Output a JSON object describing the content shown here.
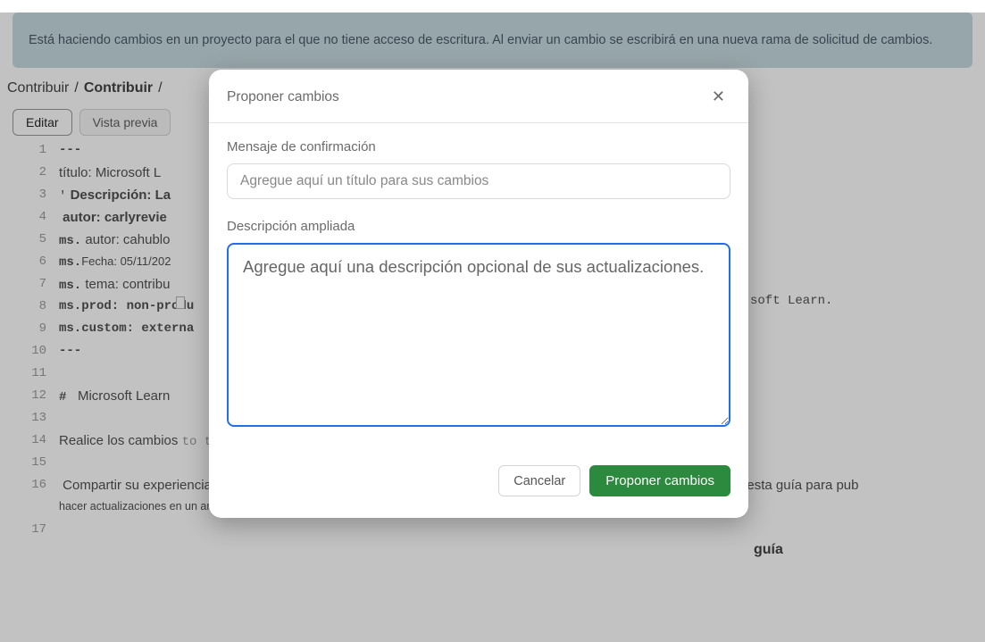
{
  "banner": {
    "text": "Está haciendo cambios en un proyecto para el que no tiene acceso de escritura. Al enviar un cambio se escribirá en una nueva rama de solicitud de cambios."
  },
  "breadcrumbs": {
    "items": [
      "Contribuir",
      "Contribuir"
    ],
    "sep": "/"
  },
  "tabs": {
    "edit": "Editar",
    "preview": "Vista previa"
  },
  "editor": {
    "line_numbers": [
      "1",
      "2",
      "3",
      "4",
      "5",
      "6",
      "7",
      "8",
      "9",
      "10",
      "11",
      "12",
      "13",
      "14",
      "15",
      "16",
      "",
      "17"
    ],
    "lines": [
      {
        "mono": "---"
      },
      {
        "sans": "título: Microsoft L"
      },
      {
        "sans": " Descripción: La ",
        "bold": true,
        "quote": true
      },
      {
        "sans": " autor: carlyrevie",
        "bold": true
      },
      {
        "mono": "ms.",
        "sans": " autor: cahublo"
      },
      {
        "mono": "ms.",
        "sans": "Fecha: 05/11/202",
        "small": true
      },
      {
        "mono": "ms.",
        "sans": " tema: contribu"
      },
      {
        "mono": "ms.prod: non-produ"
      },
      {
        "mono": "ms.custom: externa"
      },
      {
        "mono": "---"
      },
      {
        "mono": ""
      },
      {
        "mono": "# ",
        "sans": " Microsoft Learn"
      },
      {
        "mono": ""
      },
      {
        "sans": "Realice los cambios ",
        "mono_after": "to the article. Welcome to the Microsoft Learn documentation contributor "
      },
      {
        "mono": ""
      },
      {
        "sans": " Compartir su experiencia con los demás en Microsoft Learn ayuda a todos a conseguir más. Use la información de esta guía para pub"
      },
      {
        "sans_small": "hacer actualizaciones en un artículo publicado existente."
      },
      {
        "mono": ""
      }
    ],
    "right_extra": "soft Learn.",
    "guia": "guía"
  },
  "dialog": {
    "title": "Proponer cambios",
    "close": "✕",
    "commit_label": "Mensaje de confirmación",
    "commit_placeholder": "Agregue aquí un título para sus cambios",
    "desc_label": "Descripción ampliada",
    "desc_placeholder": "Agregue aquí una descripción opcional de sus actualizaciones.",
    "cancel": "Cancelar",
    "submit": "Proponer cambios"
  }
}
